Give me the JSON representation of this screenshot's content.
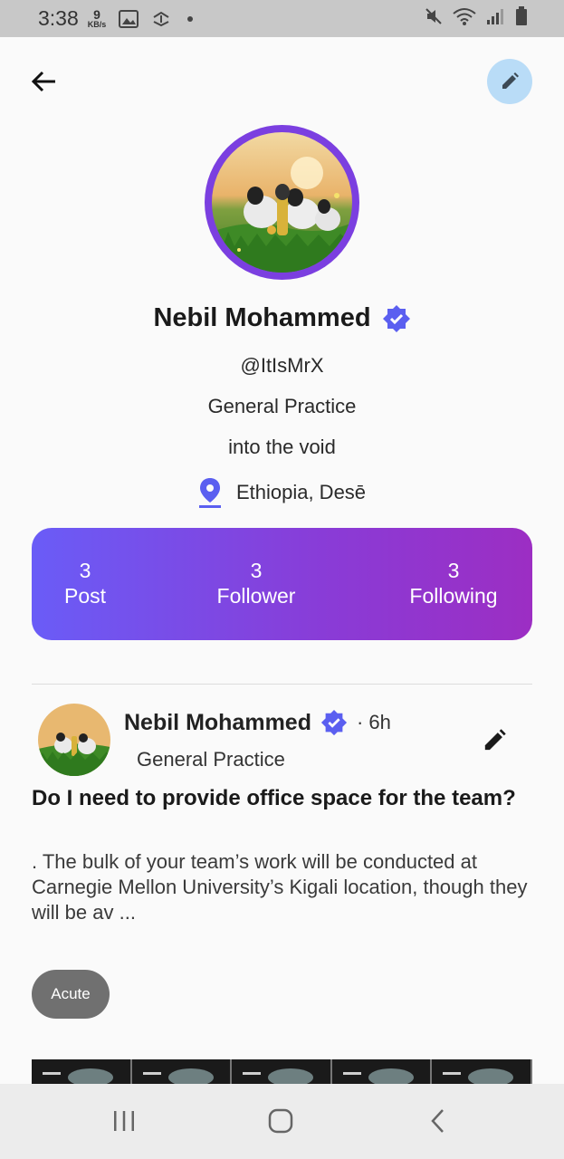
{
  "status_bar": {
    "time": "3:38",
    "net_speed_value": "9",
    "net_speed_unit": "KB/s"
  },
  "profile": {
    "name": "Nebil Mohammed",
    "handle": "@ItIsMrX",
    "specialty": "General Practice",
    "bio": "into the void",
    "location": "Ethiopia, Desē"
  },
  "stats": [
    {
      "count": "3",
      "label": "Post"
    },
    {
      "count": "3",
      "label": "Follower"
    },
    {
      "count": "3",
      "label": "Following"
    }
  ],
  "post": {
    "author": "Nebil Mohammed",
    "time": "· 6h",
    "specialty": "General Practice",
    "title": "Do I need to provide office space for the team?",
    "body": ". The bulk of your team’s work will be conducted at Carnegie Mellon University’s Kigali location, though they will be av ...",
    "tag": "Acute"
  },
  "colors": {
    "accent": "#6a5cf7",
    "gradient_end": "#9c2ec3",
    "verified": "#5b5ff0",
    "edit_fab_bg": "#b9dcf7",
    "tag_bg": "#707070"
  }
}
